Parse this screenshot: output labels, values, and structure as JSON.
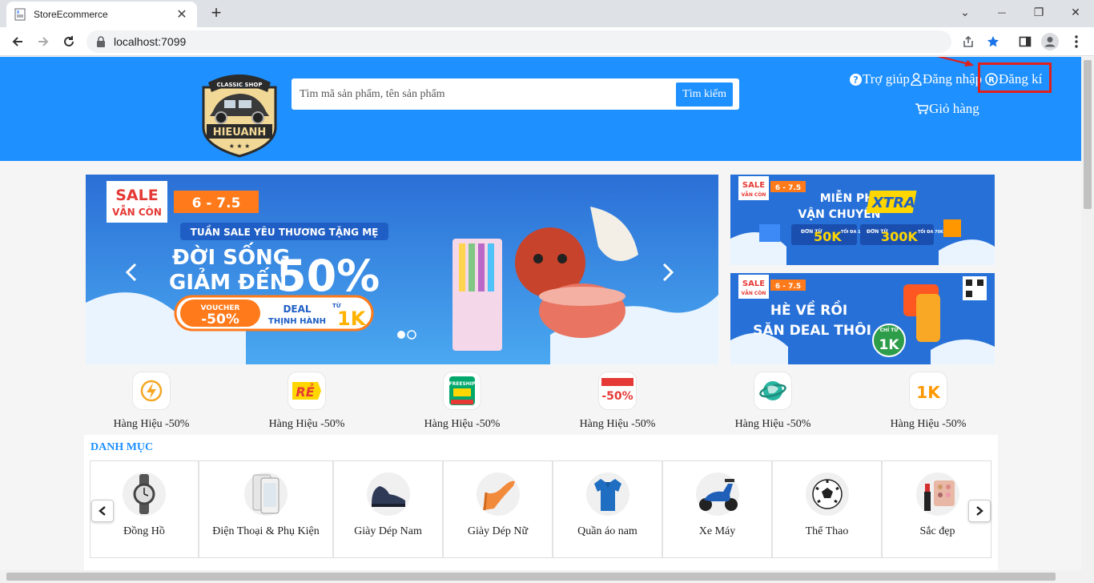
{
  "browser": {
    "tab_title": "StoreEcommerce",
    "tab_close": "✕",
    "new_tab": "+",
    "url": "localhost:7099",
    "minimize": "⌄",
    "restore": "—",
    "maximize": "❐",
    "close": "✕"
  },
  "header": {
    "logo_top": "CLASSIC SHOP",
    "logo_name": "HIEUANH",
    "search_placeholder": "Tìm mã sản phẩm, tên sản phẩm",
    "search_button": "Tìm kiếm",
    "help": "Trợ giúp",
    "login": "Đăng nhập",
    "register": "Đăng kí",
    "cart": "Giỏ hàng"
  },
  "banners": {
    "main": {
      "sale_badge_1": "SALE",
      "sale_badge_2": "VẪN CÒN",
      "date": "6 - 7.5",
      "subtitle": "TUẦN SALE YÊU THƯƠNG TẶNG MẸ",
      "headline_1": "ĐỜI SỐNG",
      "headline_2": "GIẢM ĐẾN",
      "percent": "50%",
      "voucher_label": "VOUCHER",
      "voucher_value": "-50%",
      "deal_label": "DEAL",
      "deal_sub": "THỊNH HÀNH",
      "deal_from": "TỪ",
      "deal_value": "1K"
    },
    "side1": {
      "sale_badge_1": "SALE",
      "sale_badge_2": "VẪN CÒN",
      "date": "6 - 7.5",
      "line1": "MIỄN PHÍ",
      "line2": "VẬN CHUYỂN",
      "xtra": "XTRA",
      "chip1_prefix": "ĐƠN TỪ",
      "chip1_value": "50K",
      "chip1_max": "TỐI ĐA 15K",
      "chip2_prefix": "ĐƠN TỪ",
      "chip2_value": "300K",
      "chip2_max": "TỐI ĐA 70K"
    },
    "side2": {
      "sale_badge_1": "SALE",
      "sale_badge_2": "VẪN CÒN",
      "date": "6 - 7.5",
      "line1": "HÈ VỀ RỒI",
      "line2": "SĂN DEAL THÔI",
      "chip_prefix": "CHỈ TỪ",
      "chip_value": "1K"
    }
  },
  "promos": [
    {
      "label": "Hàng Hiệu -50%",
      "icon": "lightning-icon"
    },
    {
      "label": "Hàng Hiệu -50%",
      "icon": "re-tag-icon",
      "badge": "RẺ"
    },
    {
      "label": "Hàng Hiệu -50%",
      "icon": "freeship-icon",
      "badge": "FREESHIP"
    },
    {
      "label": "Hàng Hiệu -50%",
      "icon": "brand-discount-icon",
      "badge": "-50%"
    },
    {
      "label": "Hàng Hiệu -50%",
      "icon": "global-icon"
    },
    {
      "label": "Hàng Hiệu -50%",
      "icon": "1k-icon",
      "badge": "1K"
    }
  ],
  "categories": {
    "title": "DANH MỤC",
    "items": [
      {
        "label": "Đồng Hồ",
        "icon": "watch-icon"
      },
      {
        "label": "Điện Thoại & Phụ Kiện",
        "icon": "phone-icon"
      },
      {
        "label": "Giày Dép Nam",
        "icon": "mens-shoe-icon"
      },
      {
        "label": "Giày Dép Nữ",
        "icon": "high-heel-icon"
      },
      {
        "label": "Quần áo nam",
        "icon": "polo-shirt-icon"
      },
      {
        "label": "Xe Máy",
        "icon": "scooter-icon"
      },
      {
        "label": "Thể Thao",
        "icon": "soccer-ball-icon"
      },
      {
        "label": "Sắc đẹp",
        "icon": "cosmetics-icon"
      }
    ]
  },
  "colors": {
    "brand_blue": "#1e90ff",
    "highlight_red": "#e0201b"
  }
}
